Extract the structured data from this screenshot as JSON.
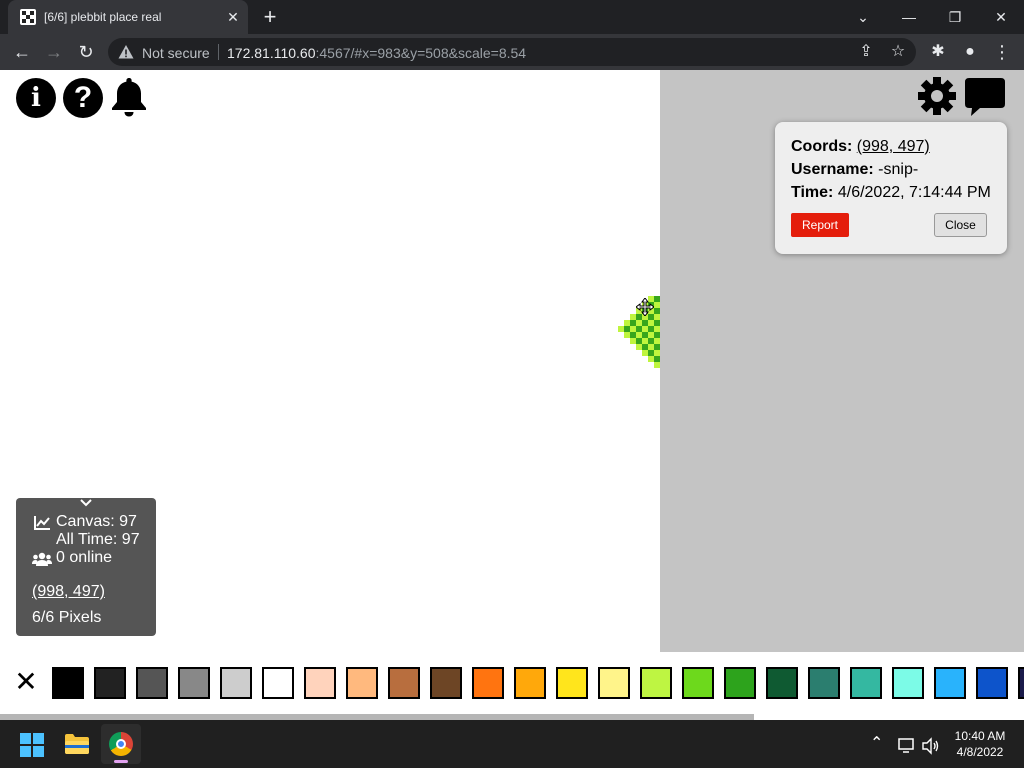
{
  "browser": {
    "tab": {
      "title": "[6/6] plebbit place real",
      "close_glyph": "✕"
    },
    "new_tab_glyph": "+",
    "window_controls": {
      "menu": "⌄",
      "minimize": "—",
      "restore": "❐",
      "close": "✕"
    },
    "nav": {
      "back": "←",
      "forward": "→",
      "reload": "↻"
    },
    "address": {
      "security_label": "Not secure",
      "host": "172.81.110.60",
      "rest": ":4567/#x=983&y=508&scale=8.54"
    },
    "actions": {
      "share": "⇪",
      "bookmark": "☆",
      "extensions": "✱",
      "profile": "●",
      "menu": "⋮"
    }
  },
  "app": {
    "top_icons": {
      "info": "i",
      "help": "?"
    },
    "pixel_info": {
      "coords_label": "Coords:",
      "coords_value": "(998, 497)",
      "username_label": "Username:",
      "username_value": "-snip-",
      "time_label": "Time:",
      "time_value": "4/6/2022, 7:14:44 PM",
      "report_label": "Report",
      "close_label": "Close"
    },
    "stats": {
      "canvas_line": "Canvas: 97",
      "alltime_line": "All Time: 97",
      "online_line": "0 online",
      "coords_link": "(998, 497)",
      "pixels_line": "6/6 Pixels"
    },
    "palette": {
      "close_glyph": "✕",
      "colors": [
        "#000000",
        "#222222",
        "#555555",
        "#888888",
        "#cdcdcd",
        "#ffffff",
        "#ffd3bc",
        "#ffb97e",
        "#b86e3e",
        "#6d4525",
        "#ff7410",
        "#ffa80b",
        "#ffe51c",
        "#fff48a",
        "#bef542",
        "#6dd91c",
        "#2da31c",
        "#0f5a32",
        "#2b7e6f",
        "#34b8a1",
        "#7cfbe7",
        "#29b3fc",
        "#0d54cb",
        "#1a1a4a"
      ]
    },
    "art_colors": {
      "dark": "#37a51c",
      "light": "#bff53e"
    }
  },
  "taskbar": {
    "tray_chevron": "⌃",
    "time": "10:40 AM",
    "date": "4/8/2022"
  }
}
